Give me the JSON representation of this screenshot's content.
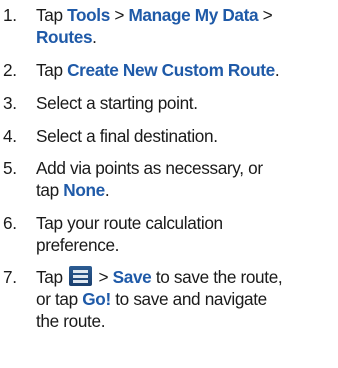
{
  "steps": [
    {
      "num": "1.",
      "lines": [
        [
          "Tap ",
          {
            "k": "Tools"
          },
          " > ",
          {
            "k": "Manage My Data"
          },
          " >"
        ],
        [
          {
            "k": "Routes"
          },
          "."
        ]
      ]
    },
    {
      "num": "2.",
      "lines": [
        [
          "Tap ",
          {
            "k": "Create New Custom Route"
          },
          "."
        ]
      ]
    },
    {
      "num": "3.",
      "lines": [
        [
          "Select a starting point."
        ]
      ]
    },
    {
      "num": "4.",
      "lines": [
        [
          "Select a final destination."
        ]
      ]
    },
    {
      "num": "5.",
      "lines": [
        [
          "Add via points as necessary, or"
        ],
        [
          "tap ",
          {
            "k": "None"
          },
          "."
        ]
      ]
    },
    {
      "num": "6.",
      "lines": [
        [
          "Tap your route calculation"
        ],
        [
          "preference."
        ]
      ]
    },
    {
      "num": "7.",
      "lines": [
        [
          "Tap ",
          {
            "icon": "menu-icon"
          },
          " > ",
          {
            "k": "Save"
          },
          " to save the route,"
        ],
        [
          "or tap ",
          {
            "k": "Go!"
          },
          " to save and navigate"
        ],
        [
          "the route."
        ]
      ]
    }
  ]
}
